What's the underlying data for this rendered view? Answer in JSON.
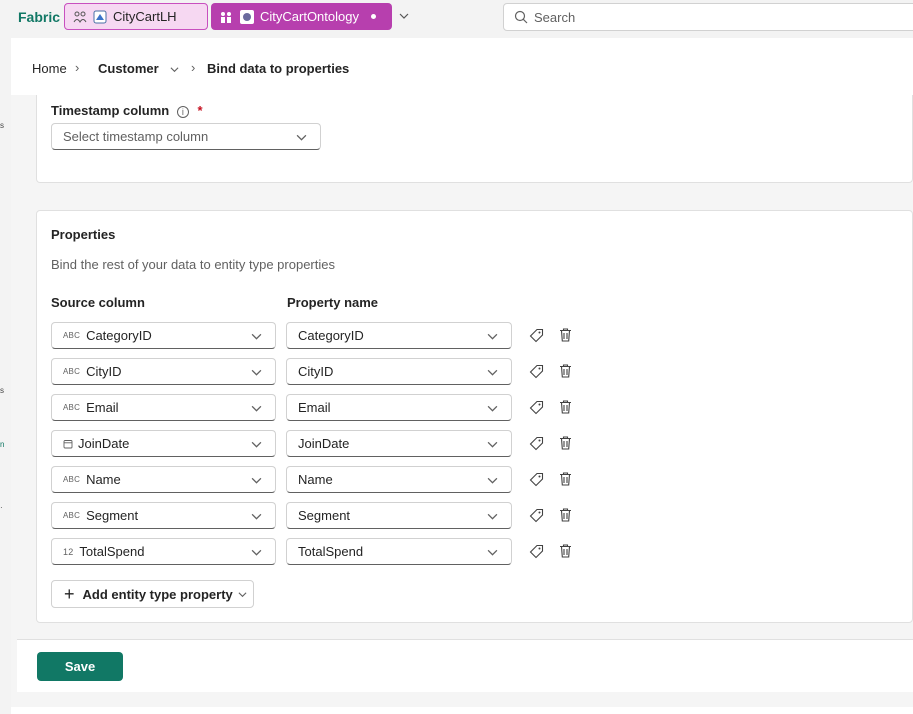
{
  "topbar": {
    "brand": "Fabric",
    "pill1_label": "CityCartLH",
    "pill2_label": "CityCartOntology",
    "search_placeholder": "Search"
  },
  "breadcrumb": {
    "home": "Home",
    "customer": "Customer",
    "current": "Bind data to properties"
  },
  "timestamp": {
    "label": "Timestamp column",
    "required_mark": "*",
    "placeholder": "Select timestamp column"
  },
  "properties": {
    "title": "Properties",
    "description": "Bind the rest of your data to entity type properties",
    "col_source": "Source column",
    "col_property": "Property name",
    "rows": [
      {
        "type_icon": "ABC",
        "source": "CategoryID",
        "property": "CategoryID"
      },
      {
        "type_icon": "ABC",
        "source": "CityID",
        "property": "CityID"
      },
      {
        "type_icon": "ABC",
        "source": "Email",
        "property": "Email"
      },
      {
        "type_icon": "calendar-icon",
        "source": "JoinDate",
        "property": "JoinDate"
      },
      {
        "type_icon": "ABC",
        "source": "Name",
        "property": "Name"
      },
      {
        "type_icon": "ABC",
        "source": "Segment",
        "property": "Segment"
      },
      {
        "type_icon": "12",
        "source": "TotalSpend",
        "property": "TotalSpend"
      }
    ],
    "add_label": "Add entity type property"
  },
  "footer": {
    "save_label": "Save"
  },
  "colors": {
    "brand": "#117865",
    "ontology_pill": "#b73fae",
    "lakehouse_pill": "#f6d8f2"
  }
}
